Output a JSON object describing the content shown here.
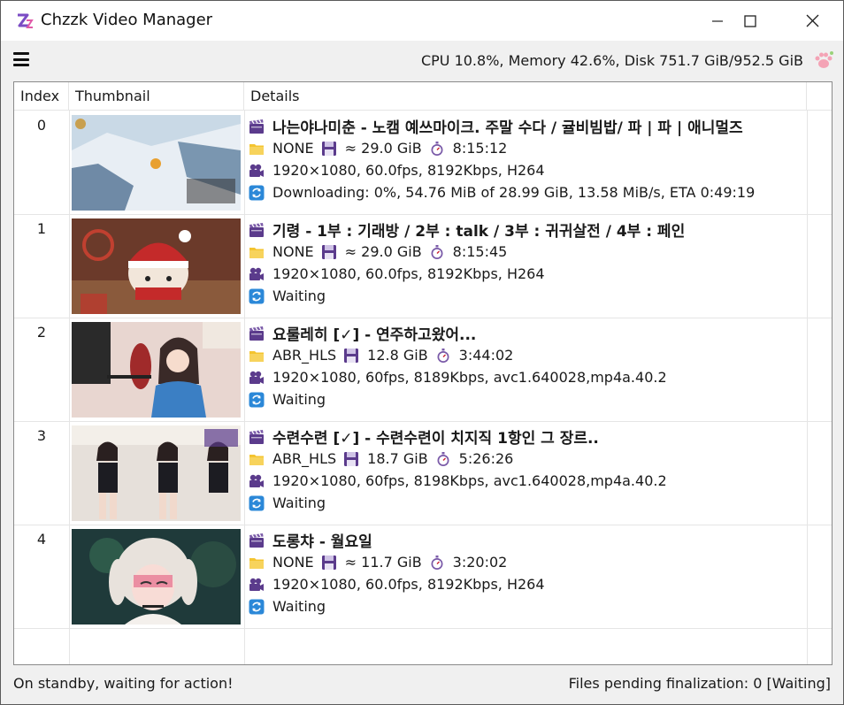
{
  "window": {
    "title": "Chzzk Video Manager"
  },
  "toolbar": {
    "sysinfo": "CPU 10.8%, Memory 42.6%, Disk 751.7 GiB/952.5 GiB",
    "menu_icon": "hamburger-icon",
    "paw_icon": "paw-icon"
  },
  "table": {
    "headers": [
      "Index",
      "Thumbnail",
      "Details"
    ],
    "rows": [
      {
        "index": "0",
        "title": "나는야나미춘 - 노캠 예쓰마이크. 주말 수다 / 귤비빔밥/ 파 | 파 | 애니멀즈",
        "format": "NONE",
        "size": "≈ 29.0 GiB",
        "duration": "8:15:12",
        "video": "1920×1080, 60.0fps, 8192Kbps, H264",
        "status": "Downloading: 0%, 54.76 MiB of 28.99 GiB, 13.58 MiB/s, ETA 0:49:19"
      },
      {
        "index": "1",
        "title": "기령 - 1부 : 기래방 / 2부 : talk / 3부 : 귀귀살전 / 4부 : 페인",
        "format": "NONE",
        "size": "≈ 29.0 GiB",
        "duration": "8:15:45",
        "video": "1920×1080, 60.0fps, 8192Kbps, H264",
        "status": "Waiting"
      },
      {
        "index": "2",
        "title": "요룰레히 [✓] - 연주하고왔어...",
        "format": "ABR_HLS",
        "size": "12.8 GiB",
        "duration": "3:44:02",
        "video": "1920×1080, 60fps, 8189Kbps, avc1.640028,mp4a.40.2",
        "status": "Waiting"
      },
      {
        "index": "3",
        "title": "수련수련 [✓] - 수련수련이 치지직 1항인 그 장르..",
        "format": "ABR_HLS",
        "size": "18.7 GiB",
        "duration": "5:26:26",
        "video": "1920×1080, 60fps, 8198Kbps, avc1.640028,mp4a.40.2",
        "status": "Waiting"
      },
      {
        "index": "4",
        "title": "도롱챠 - 월요일",
        "format": "NONE",
        "size": "≈ 11.7 GiB",
        "duration": "3:20:02",
        "video": "1920×1080, 60.0fps, 8192Kbps, H264",
        "status": "Waiting"
      }
    ]
  },
  "statusbar": {
    "left": "On standby, waiting for action!",
    "right": "Files pending finalization: 0 [Waiting]"
  },
  "colors": {
    "accent_purple": "#6b4aa0",
    "folder_yellow": "#f4c430",
    "disk_purple": "#5b3b8c",
    "refresh_blue": "#2b88d8"
  }
}
